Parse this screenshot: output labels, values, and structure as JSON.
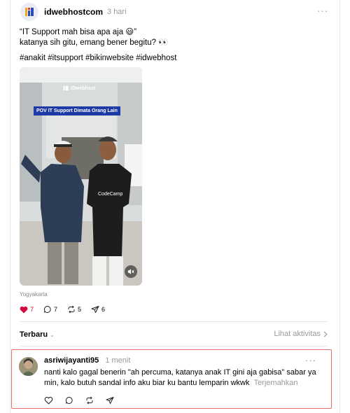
{
  "post": {
    "author": "idwebhostcom",
    "time": "3 hari",
    "caption_line1": "“IT Support mah bisa apa aja 😃”",
    "caption_line2": "katanya sih gitu, emang bener begitu? 👀",
    "hashtags": "#anakit #itsupport #bikinwebsite #idwebhost",
    "media_logo": "IDwebhost",
    "media_banner": "POV IT Support Dimata Orang Lain",
    "media_shirt_text": "CodeCamp",
    "location": "Yogyakarta",
    "likes": "7",
    "comments": "7",
    "reposts": "5",
    "shares": "6",
    "liked": true
  },
  "sort": {
    "label": "Terbaru",
    "activity_link": "Lihat aktivitas"
  },
  "comment": {
    "author": "asriwijayanti95",
    "time": "1 menit",
    "text": "nanti kalo gagal benerin \"ah percuma, katanya anak IT gini aja gabisa\" sabar ya min, kalo butuh sandal info aku biar ku bantu lemparin wkwk",
    "translate": "Terjemahkan"
  },
  "colors": {
    "like": "#d10a3b",
    "banner": "#1e3aa6",
    "highlight_border": "#e56b6b"
  },
  "icons": [
    "idwebhost-logo-icon",
    "more-icon",
    "heart-icon",
    "comment-icon",
    "repost-icon",
    "share-icon",
    "mute-icon",
    "chevron-down-icon",
    "chevron-right-icon"
  ]
}
